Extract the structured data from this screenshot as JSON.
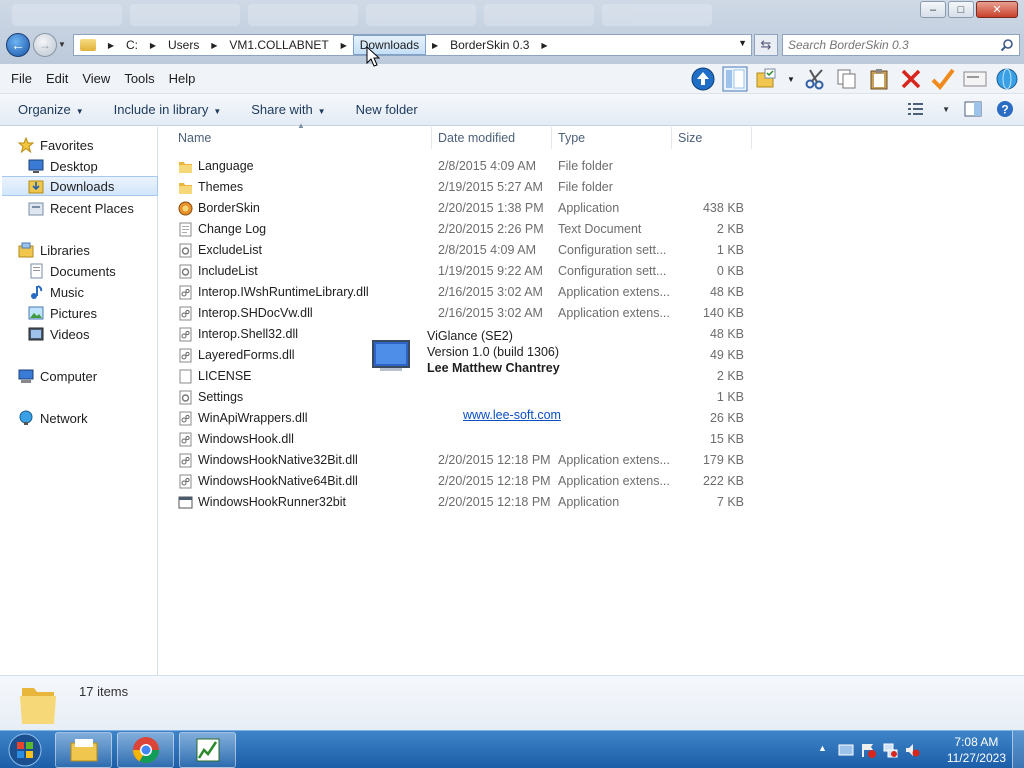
{
  "address": {
    "crumbs": [
      "C:",
      "Users",
      "VM1.COLLABNET",
      "Downloads",
      "BorderSkin 0.3"
    ],
    "search_placeholder": "Search BorderSkin 0.3"
  },
  "menu": [
    "File",
    "Edit",
    "View",
    "Tools",
    "Help"
  ],
  "commands": {
    "organize": "Organize",
    "include": "Include in library",
    "share": "Share with",
    "new_folder": "New folder"
  },
  "nav": {
    "favorites": "Favorites",
    "desktop": "Desktop",
    "downloads": "Downloads",
    "recent": "Recent Places",
    "libraries": "Libraries",
    "documents": "Documents",
    "music": "Music",
    "pictures": "Pictures",
    "videos": "Videos",
    "computer": "Computer",
    "network": "Network"
  },
  "columns": {
    "name": "Name",
    "date": "Date modified",
    "type": "Type",
    "size": "Size"
  },
  "files": [
    {
      "name": "Language",
      "date": "2/8/2015 4:09 AM",
      "type": "File folder",
      "size": "",
      "icon": "folder-icon"
    },
    {
      "name": "Themes",
      "date": "2/19/2015 5:27 AM",
      "type": "File folder",
      "size": "",
      "icon": "folder-icon"
    },
    {
      "name": "BorderSkin",
      "date": "2/20/2015 1:38 PM",
      "type": "Application",
      "size": "438 KB",
      "icon": "app-icon"
    },
    {
      "name": "Change Log",
      "date": "2/20/2015 2:26 PM",
      "type": "Text Document",
      "size": "2 KB",
      "icon": "text-file-icon"
    },
    {
      "name": "ExcludeList",
      "date": "2/8/2015 4:09 AM",
      "type": "Configuration sett...",
      "size": "1 KB",
      "icon": "config-file-icon"
    },
    {
      "name": "IncludeList",
      "date": "1/19/2015 9:22 AM",
      "type": "Configuration sett...",
      "size": "0 KB",
      "icon": "config-file-icon"
    },
    {
      "name": "Interop.IWshRuntimeLibrary.dll",
      "date": "2/16/2015 3:02 AM",
      "type": "Application extens...",
      "size": "48 KB",
      "icon": "dll-file-icon"
    },
    {
      "name": "Interop.SHDocVw.dll",
      "date": "2/16/2015 3:02 AM",
      "type": "Application extens...",
      "size": "140 KB",
      "icon": "dll-file-icon"
    },
    {
      "name": "Interop.Shell32.dll",
      "date": "",
      "type": "",
      "size": "48 KB",
      "icon": "dll-file-icon"
    },
    {
      "name": "LayeredForms.dll",
      "date": "",
      "type": "",
      "size": "49 KB",
      "icon": "dll-file-icon"
    },
    {
      "name": "LICENSE",
      "date": "",
      "type": "",
      "size": "2 KB",
      "icon": "blank-file-icon"
    },
    {
      "name": "Settings",
      "date": "",
      "type": "",
      "size": "1 KB",
      "icon": "config-file-icon"
    },
    {
      "name": "WinApiWrappers.dll",
      "date": "",
      "type": "",
      "size": "26 KB",
      "icon": "dll-file-icon"
    },
    {
      "name": "WindowsHook.dll",
      "date": "",
      "type": "",
      "size": "15 KB",
      "icon": "dll-file-icon"
    },
    {
      "name": "WindowsHookNative32Bit.dll",
      "date": "2/20/2015 12:18 PM",
      "type": "Application extens...",
      "size": "179 KB",
      "icon": "dll-file-icon"
    },
    {
      "name": "WindowsHookNative64Bit.dll",
      "date": "2/20/2015 12:18 PM",
      "type": "Application extens...",
      "size": "222 KB",
      "icon": "dll-file-icon"
    },
    {
      "name": "WindowsHookRunner32bit",
      "date": "2/20/2015 12:18 PM",
      "type": "Application",
      "size": "7 KB",
      "icon": "window-app-icon"
    }
  ],
  "splash": {
    "title": "ViGlance (SE2)",
    "version": "Version 1.0 (build 1306)",
    "author": "Lee Matthew Chantrey",
    "link": "www.lee-soft.com"
  },
  "status": {
    "count": "17 items"
  },
  "clock": {
    "time": "7:08 AM",
    "date": "11/27/2023"
  }
}
